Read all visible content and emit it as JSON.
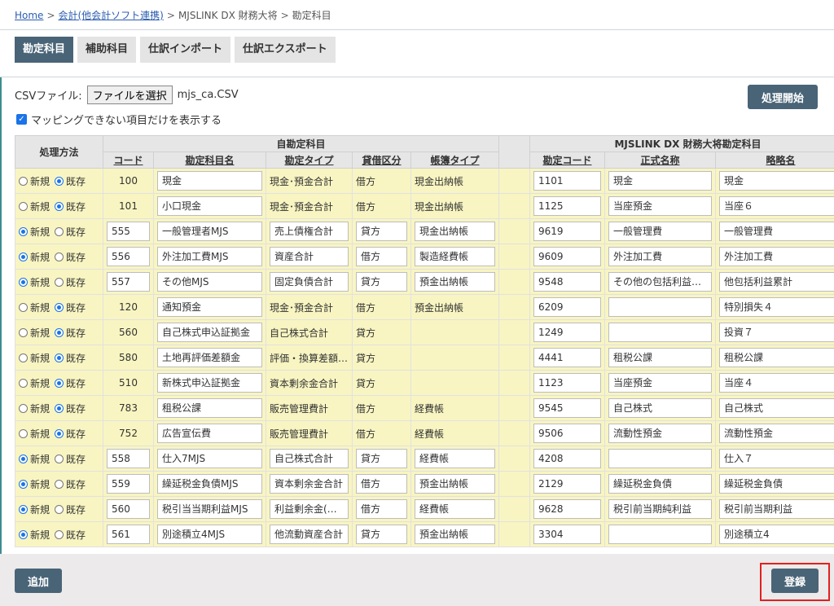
{
  "breadcrumb": {
    "home": "Home",
    "accounting": "会計(他会計ソフト連携)",
    "mjs": "MJSLINK DX 財務大将",
    "current": "勘定科目",
    "sep": ">"
  },
  "tabs": [
    "勘定科目",
    "補助科目",
    "仕訳インポート",
    "仕訳エクスポート"
  ],
  "csv": {
    "label": "CSVファイル:",
    "button": "ファイルを選択",
    "filename": "mjs_ca.CSV"
  },
  "run_button": "処理開始",
  "checkbox_label": "マッピングできない項目だけを表示する",
  "headers": {
    "method": "処理方法",
    "own_group": "自勘定科目",
    "mjs_group": "MJSLINK DX 財務大将勘定科目",
    "code": "コード",
    "name": "勘定科目名",
    "type": "勘定タイプ",
    "dc": "貸借区分",
    "book": "帳簿タイプ",
    "mjs_code": "勘定コード",
    "formal": "正式名称",
    "short": "略略名"
  },
  "radio_labels": {
    "new": "新規",
    "existing": "既存"
  },
  "rows": [
    {
      "mode": "existing",
      "code": "100",
      "name": "現金",
      "type": "現金･預金合計",
      "dc": "借方",
      "book": "現金出納帳",
      "mcode": "1101",
      "formal": "現金",
      "short": "現金"
    },
    {
      "mode": "existing",
      "code": "101",
      "name": "小口現金",
      "type": "現金･預金合計",
      "dc": "借方",
      "book": "現金出納帳",
      "mcode": "1125",
      "formal": "当座預金",
      "short": "当座６"
    },
    {
      "mode": "new",
      "code": "555",
      "name": "一般管理者MJS",
      "type": "売上債権合計",
      "dc": "貸方",
      "book": "現金出納帳",
      "mcode": "9619",
      "formal": "一般管理費",
      "short": "一般管理費"
    },
    {
      "mode": "new",
      "code": "556",
      "name": "外注加工費MJS",
      "type": "資産合計",
      "dc": "借方",
      "book": "製造経費帳",
      "mcode": "9609",
      "formal": "外注加工費",
      "short": "外注加工費"
    },
    {
      "mode": "new",
      "code": "557",
      "name": "その他MJS",
      "type": "固定負債合計",
      "dc": "貸方",
      "book": "預金出納帳",
      "mcode": "9548",
      "formal": "その他の包括利益…",
      "short": "他包括利益累計"
    },
    {
      "mode": "existing",
      "code": "120",
      "name": "通知預金",
      "type": "現金･預金合計",
      "dc": "借方",
      "book": "預金出納帳",
      "mcode": "6209",
      "formal": "",
      "short": "特別損失４"
    },
    {
      "mode": "existing",
      "code": "560",
      "name": "自己株式申込証拠金",
      "type": "自己株式合計",
      "dc": "貸方",
      "book": "",
      "mcode": "1249",
      "formal": "",
      "short": "投資７"
    },
    {
      "mode": "existing",
      "code": "580",
      "name": "土地再評価差額金",
      "type": "評価・換算差額…",
      "dc": "貸方",
      "book": "",
      "mcode": "4441",
      "formal": "租税公課",
      "short": "租税公課"
    },
    {
      "mode": "existing",
      "code": "510",
      "name": "新株式申込証拠金",
      "type": "資本剰余金合計",
      "dc": "貸方",
      "book": "",
      "mcode": "1123",
      "formal": "当座預金",
      "short": "当座４"
    },
    {
      "mode": "existing",
      "code": "783",
      "name": "租税公課",
      "type": "販売管理費計",
      "dc": "借方",
      "book": "経費帳",
      "mcode": "9545",
      "formal": "自己株式",
      "short": "自己株式"
    },
    {
      "mode": "existing",
      "code": "752",
      "name": "広告宣伝費",
      "type": "販売管理費計",
      "dc": "借方",
      "book": "経費帳",
      "mcode": "9506",
      "formal": "流動性預金",
      "short": "流動性預金"
    },
    {
      "mode": "new",
      "code": "558",
      "name": "仕入7MJS",
      "type": "自己株式合計",
      "dc": "貸方",
      "book": "経費帳",
      "mcode": "4208",
      "formal": "",
      "short": "仕入７"
    },
    {
      "mode": "new",
      "code": "559",
      "name": "繰延税金負債MJS",
      "type": "資本剰余金合計",
      "dc": "借方",
      "book": "預金出納帳",
      "mcode": "2129",
      "formal": "繰延税金負債",
      "short": "繰延税金負債"
    },
    {
      "mode": "new",
      "code": "560",
      "name": "税引当当期利益MJS",
      "type": "利益剰余金(…",
      "dc": "借方",
      "book": "経費帳",
      "mcode": "9628",
      "formal": "税引前当期純利益",
      "short": "税引前当期利益"
    },
    {
      "mode": "new",
      "code": "561",
      "name": "別途積立4MJS",
      "type": "他流動資産合計",
      "dc": "貸方",
      "book": "預金出納帳",
      "mcode": "3304",
      "formal": "",
      "short": "別途積立4"
    }
  ],
  "add_button": "追加",
  "register_button": "登録"
}
